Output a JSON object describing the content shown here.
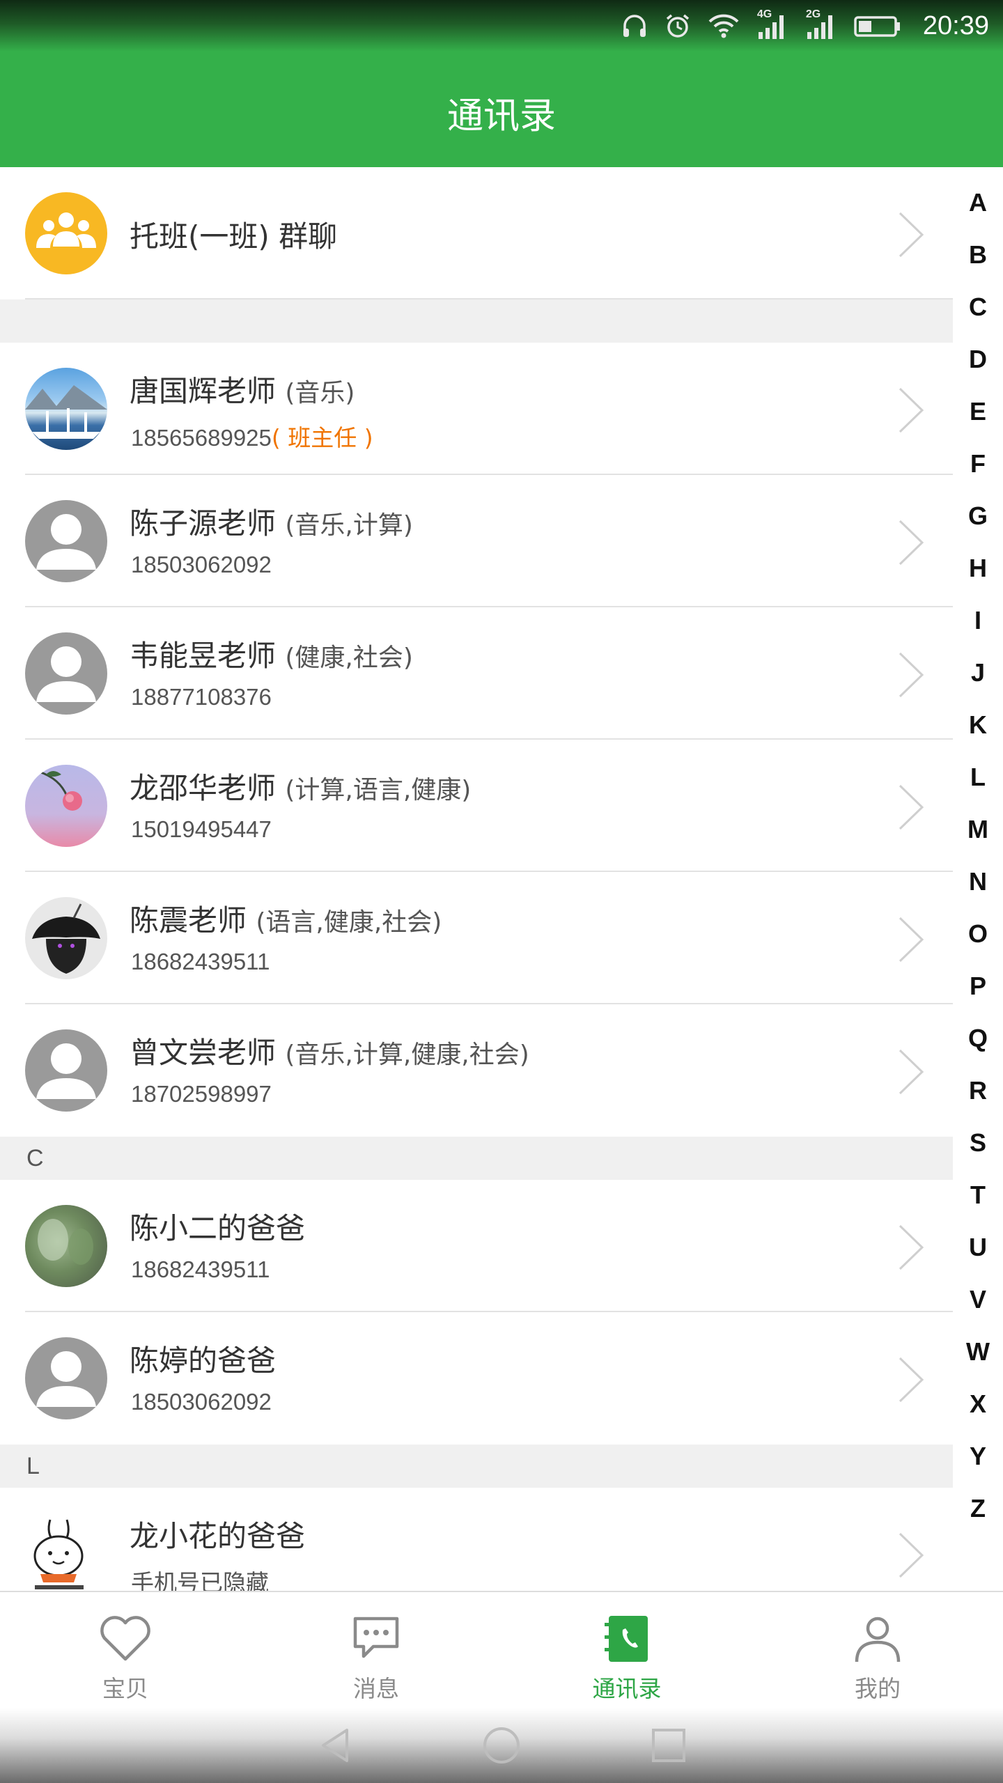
{
  "status_bar": {
    "time": "20:39",
    "network_1": "4G",
    "network_2": "2G",
    "icons": [
      "headphones-icon",
      "alarm-icon",
      "wifi-icon",
      "signal-icon",
      "signal-icon",
      "battery-icon"
    ]
  },
  "header": {
    "title": "通讯录"
  },
  "group_chat": {
    "name": "托班(一班) 群聊",
    "icon": "group-icon",
    "color": "#f8b823"
  },
  "teachers": [
    {
      "name": "唐国辉老师",
      "subjects": "(音乐)",
      "phone": "18565689925",
      "role": "( 班主任 )",
      "avatar": "photo-harbor"
    },
    {
      "name": "陈子源老师",
      "subjects": "(音乐,计算)",
      "phone": "18503062092",
      "avatar": "default-person-icon"
    },
    {
      "name": "韦能昱老师",
      "subjects": "(健康,社会)",
      "phone": "18877108376",
      "avatar": "default-person-icon"
    },
    {
      "name": "龙邵华老师",
      "subjects": "(计算,语言,健康)",
      "phone": "15019495447",
      "avatar": "photo-rose"
    },
    {
      "name": "陈震老师",
      "subjects": "(语言,健康,社会)",
      "phone": "18682439511",
      "avatar": "photo-dark-figure"
    },
    {
      "name": "曾文尝老师",
      "subjects": "(音乐,计算,健康,社会)",
      "phone": "18702598997",
      "avatar": "default-person-icon"
    }
  ],
  "sections": [
    {
      "letter": "C",
      "contacts": [
        {
          "name": "陈小二的爸爸",
          "phone": "18682439511",
          "avatar": "photo-blurry-green"
        },
        {
          "name": "陈婷的爸爸",
          "phone": "18503062092",
          "avatar": "default-person-icon"
        }
      ]
    },
    {
      "letter": "L",
      "contacts": [
        {
          "name": "龙小花的爸爸",
          "phone": "手机号已隐藏",
          "avatar": "rabbit-sticker"
        }
      ]
    }
  ],
  "index_letters": [
    "A",
    "B",
    "C",
    "D",
    "E",
    "F",
    "G",
    "H",
    "I",
    "J",
    "K",
    "L",
    "M",
    "N",
    "O",
    "P",
    "Q",
    "R",
    "S",
    "T",
    "U",
    "V",
    "W",
    "X",
    "Y",
    "Z"
  ],
  "bottom_nav": [
    {
      "label": "宝贝",
      "icon": "heart-icon",
      "active": false
    },
    {
      "label": "消息",
      "icon": "chat-bubble-icon",
      "active": false
    },
    {
      "label": "通讯录",
      "icon": "contacts-book-icon",
      "active": true
    },
    {
      "label": "我的",
      "icon": "person-icon",
      "active": false
    }
  ],
  "colors": {
    "header": "#34b04a",
    "active_tab": "#2ea646",
    "role_highlight": "#f07400",
    "section_bg": "#f0f0f0"
  }
}
